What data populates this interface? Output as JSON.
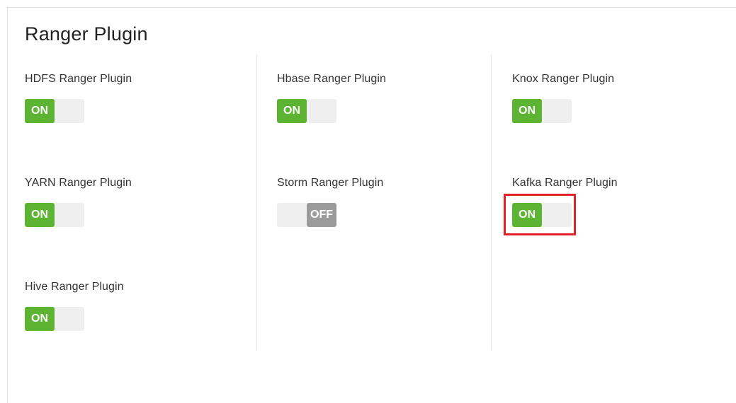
{
  "panel": {
    "title": "Ranger Plugin"
  },
  "plugins": [
    {
      "label": "HDFS Ranger Plugin",
      "state": "ON"
    },
    {
      "label": "Hbase Ranger Plugin",
      "state": "ON"
    },
    {
      "label": "Knox Ranger Plugin",
      "state": "ON"
    },
    {
      "label": "YARN Ranger Plugin",
      "state": "ON"
    },
    {
      "label": "Storm Ranger Plugin",
      "state": "OFF"
    },
    {
      "label": "Kafka Ranger Plugin",
      "state": "ON",
      "highlighted": true
    },
    {
      "label": "Hive Ranger Plugin",
      "state": "ON"
    }
  ],
  "colors": {
    "on": "#5cb432",
    "off": "#9b9b9b",
    "track": "#efefef",
    "highlight": "#e3212a"
  }
}
